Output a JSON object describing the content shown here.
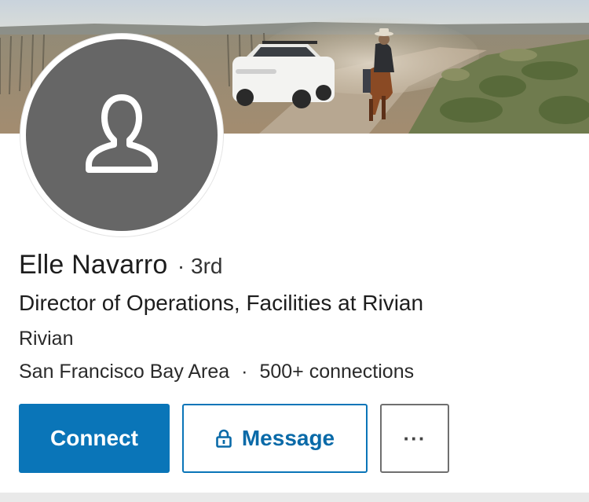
{
  "profile": {
    "name": "Elle Navarro",
    "degree": "· 3rd",
    "headline": "Director of Operations, Facilities at Rivian",
    "company": "Rivian",
    "location": "San Francisco Bay Area",
    "separator": "·",
    "connections": "500+ connections"
  },
  "actions": {
    "connect_label": "Connect",
    "message_label": "Message",
    "more_label": "···"
  },
  "icons": {
    "avatar": "person-silhouette-icon",
    "message": "lock-icon"
  },
  "colors": {
    "primary": "#0a75b8",
    "avatar_bg": "#666666"
  }
}
